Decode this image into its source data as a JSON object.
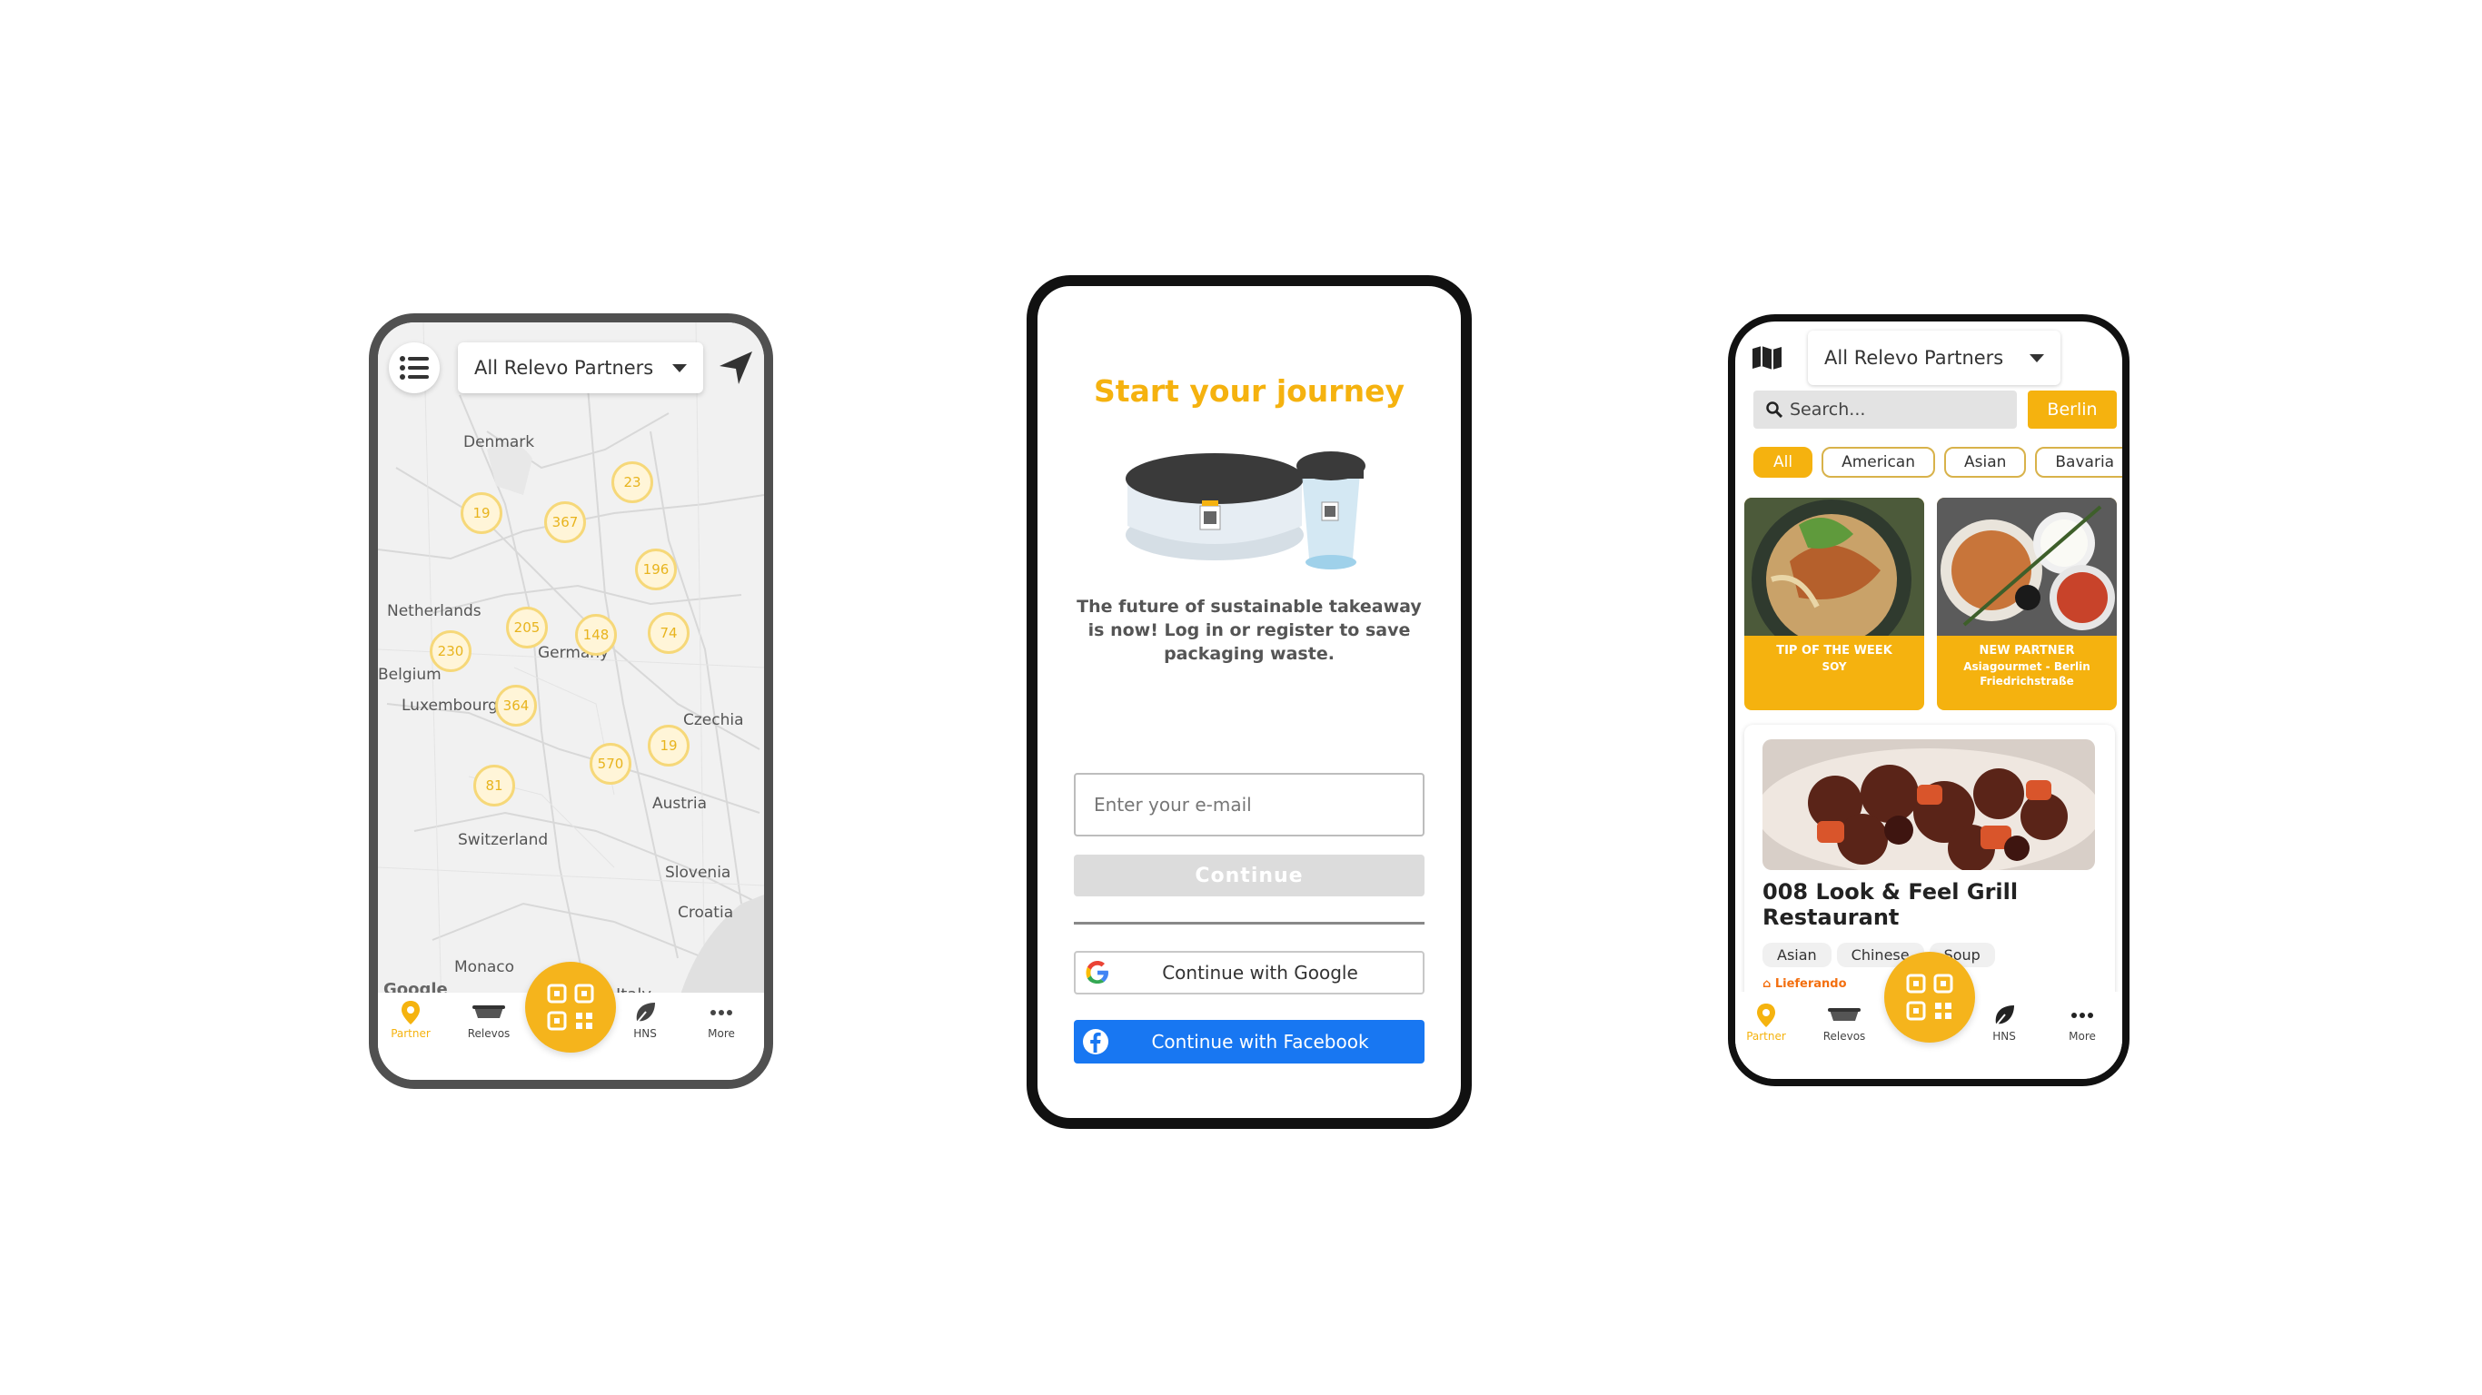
{
  "brand_color": "#f5b20f",
  "map_screen": {
    "dropdown": {
      "label": "All Relevo Partners"
    },
    "map_labels": {
      "denmark": "Denmark",
      "netherlands": "Netherlands",
      "belgium": "Belgium",
      "luxembourg": "Luxembourg",
      "germany": "Germany",
      "czechia": "Czechia",
      "austria": "Austria",
      "switzerland": "Switzerland",
      "slovenia": "Slovenia",
      "croatia": "Croatia",
      "monaco": "Monaco",
      "italy": "Italy"
    },
    "clusters": [
      "19",
      "367",
      "23",
      "196",
      "205",
      "230",
      "148",
      "74",
      "364",
      "19",
      "570",
      "81"
    ],
    "google_attribution": "Google"
  },
  "tabbar": {
    "partner": "Partner",
    "relevos": "Relevos",
    "hns": "HNS",
    "more": "More"
  },
  "login_screen": {
    "title": "Start your journey",
    "tagline": "The future of sustainable takeaway is now! Log in or register to save packaging waste.",
    "email_placeholder": "Enter your e-mail",
    "continue_label": "Continue",
    "google_label": "Continue with Google",
    "facebook_label": "Continue with Facebook"
  },
  "list_screen": {
    "dropdown": {
      "label": "All Relevo Partners"
    },
    "search_placeholder": "Search...",
    "city_button": "Berlin",
    "filters": [
      "All",
      "American",
      "Asian",
      "Bavaria"
    ],
    "featured": [
      {
        "tag": "TIP OF THE WEEK",
        "sub": "SOY"
      },
      {
        "tag": "NEW PARTNER",
        "sub": "Asiagourmet - Berlin Friedrichstraße"
      }
    ],
    "restaurant": {
      "name": "008 Look & Feel Grill Restaurant",
      "cuisines": [
        "Asian",
        "Chinese",
        "Soup"
      ],
      "delivery": "Lieferando"
    }
  }
}
